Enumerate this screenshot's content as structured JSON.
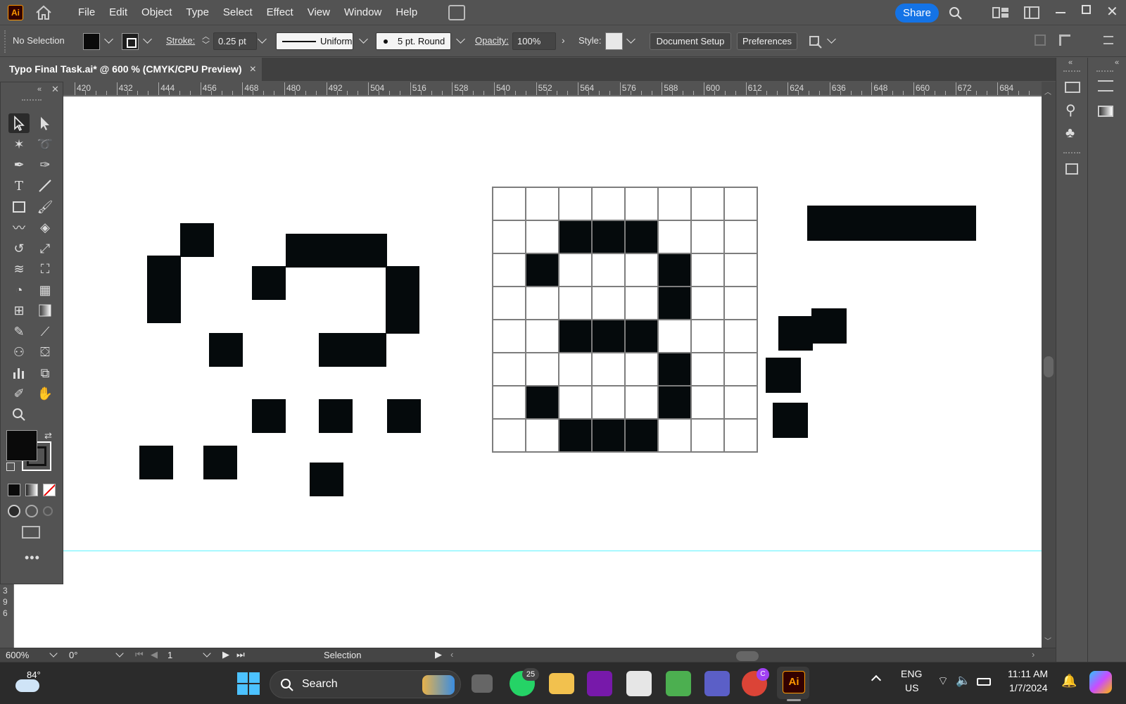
{
  "menubar": {
    "logo": "Ai",
    "items": [
      "File",
      "Edit",
      "Object",
      "Type",
      "Select",
      "Effect",
      "View",
      "Window",
      "Help"
    ],
    "share_label": "Share"
  },
  "controlbar": {
    "selection": "No Selection",
    "stroke_label": "Stroke:",
    "stroke_value": "0.25 pt",
    "profile": "Uniform",
    "brush": "5 pt. Round",
    "opacity_label": "Opacity:",
    "opacity_value": "100%",
    "style_label": "Style:",
    "document_setup": "Document Setup",
    "preferences": "Preferences"
  },
  "document": {
    "tab_title": "Typo Final Task.ai* @ 600 % (CMYK/CPU Preview)",
    "close": "×"
  },
  "ruler": {
    "labels": [
      "420",
      "432",
      "444",
      "456",
      "468",
      "480",
      "492",
      "504",
      "516",
      "528",
      "540",
      "552",
      "564",
      "576",
      "588",
      "600",
      "612",
      "624",
      "636",
      "648",
      "660",
      "672",
      "684"
    ],
    "vertical_labels": [
      "3",
      "9",
      "6"
    ]
  },
  "statusbar": {
    "zoom": "600%",
    "rotation": "0°",
    "artboard": "1",
    "tool": "Selection"
  },
  "taskbar": {
    "weather_temp": "84°",
    "search_label": "Search",
    "whatsapp_badge": "25",
    "chrome_badge": "C",
    "ai_label": "Ai",
    "lang_top": "ENG",
    "lang_bottom": "US",
    "time": "11:11 AM",
    "date": "1/7/2024"
  },
  "colors": {
    "accent": "#1473e6",
    "ai_orange": "#ff9a00",
    "guide": "#5ef3ff"
  }
}
